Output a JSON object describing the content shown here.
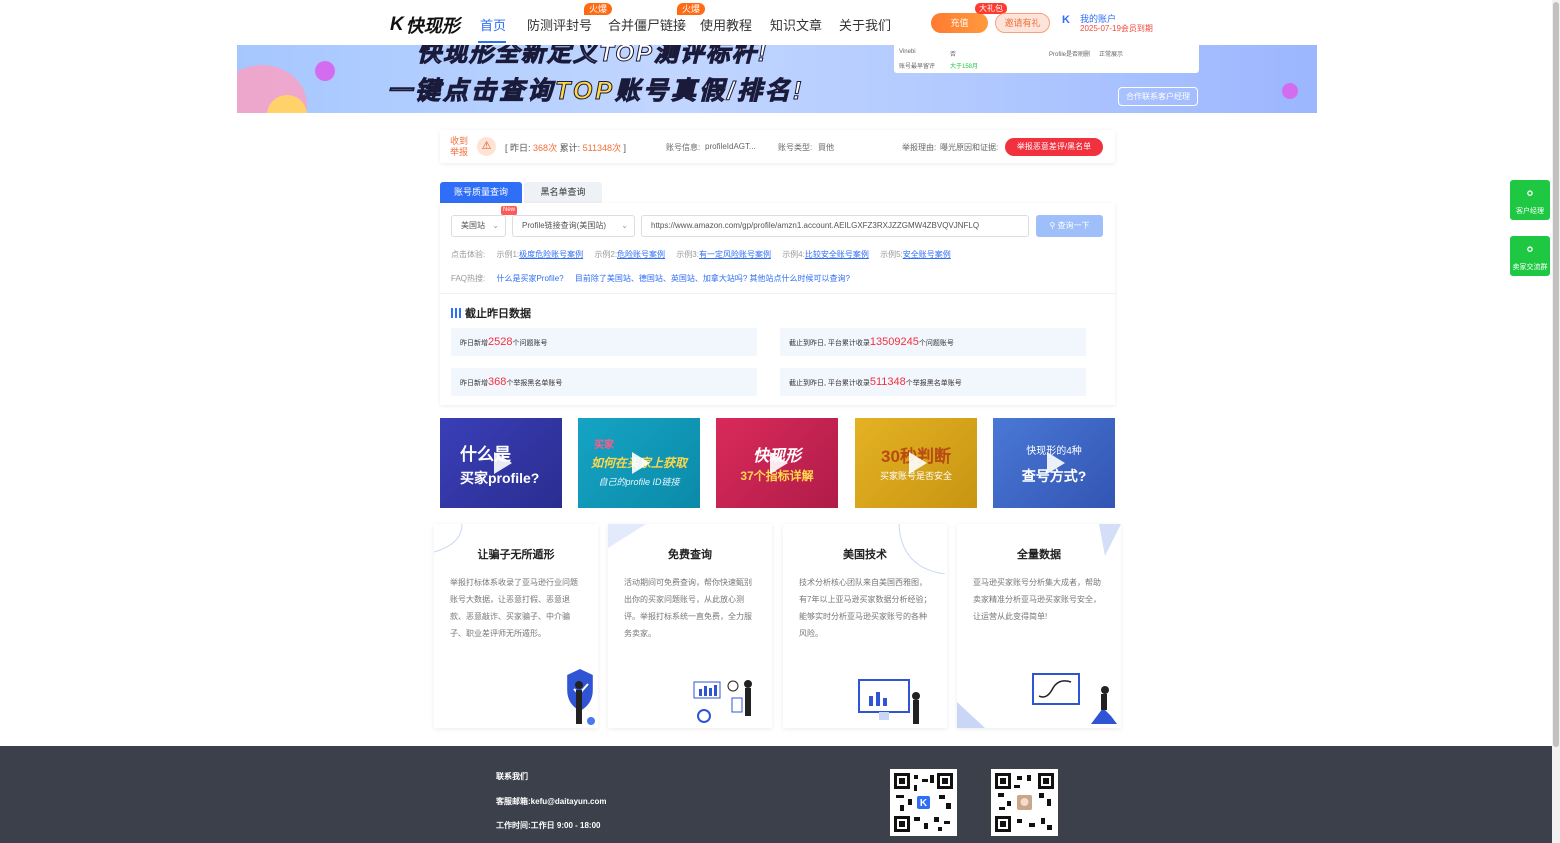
{
  "nav": {
    "logo_text": "快现形",
    "items": [
      {
        "label": "首页"
      },
      {
        "label": "防测评封号",
        "badge": "火爆"
      },
      {
        "label": "合并僵尸链接",
        "badge": "火爆"
      },
      {
        "label": "使用教程"
      },
      {
        "label": "知识文章"
      },
      {
        "label": "关于我们"
      }
    ],
    "recharge_label": "充值",
    "gift_badge": "大礼包",
    "invite_label": "邀请有礼",
    "account_label": "我的账户",
    "member_expiry": "2025-07-19会员到期"
  },
  "banner": {
    "line1": "快现形全新定义TOP测评标杆!",
    "line2_prefix": "一键点击查询",
    "line2_highlight": "TOP",
    "line2_suffix": "账号真假/排名!",
    "card_label_a": "Vinebi",
    "card_value_a": "否",
    "card_label_b": "账号最早留评",
    "card_value_b": "大于158月",
    "card_label_c": "Profile是否刷删",
    "card_value_c": "正常展示",
    "contact_label": "合作联系客户经理"
  },
  "report": {
    "label": "收到举报",
    "yesterday_label": "昨日:",
    "yesterday_value": "368次",
    "total_label": "累计:",
    "total_value": "511348次",
    "account_info_label": "账号信息:",
    "account_info_value": "profileIdAGT...",
    "account_type_label": "账号类型:",
    "account_type_value": "買他",
    "reason_label": "举报理由:",
    "reason_value": "曝光原因和证据:",
    "report_button": "举报恶意差评/黑名单"
  },
  "query": {
    "tab_active": "账号质量查询",
    "tab_inactive": "黑名单查询",
    "site_select": "美国站",
    "new_tag": "New",
    "method_select": "Profile链接查询(美国站)",
    "url_value": "https://www.amazon.com/gp/profile/amzn1.account.AEILGXFZ3RXJZZGMW4ZBVQVJNFLQ",
    "query_button": "查询一下",
    "examples_label": "点击体验:",
    "examples": [
      {
        "prefix": "示例1:",
        "link": "极度危险账号案例"
      },
      {
        "prefix": "示例2:",
        "link": "危险账号案例"
      },
      {
        "prefix": "示例3:",
        "link": "有一定风险账号案例"
      },
      {
        "prefix": "示例4:",
        "link": "比较安全账号案例"
      },
      {
        "prefix": "示例5:",
        "link": "安全账号案例"
      }
    ],
    "faq_label": "FAQ热搜:",
    "faq_links": [
      "什么是买家Profile?",
      "目前除了美国站、德国站、英国站、加拿大站吗? 其他站点什么时候可以查询?"
    ]
  },
  "stats": {
    "title": "截止昨日数据",
    "items": [
      {
        "prefix": "昨日新增",
        "value": "2528",
        "suffix": "个问题账号"
      },
      {
        "prefix": "截止到昨日, 平台累计收录",
        "value": "13509245",
        "suffix": "个问题账号"
      },
      {
        "prefix": "昨日新增",
        "value": "368",
        "suffix": "个举报黑名单账号"
      },
      {
        "prefix": "截止到昨日, 平台累计收录",
        "value": "511348",
        "suffix": "个举报黑名单账号"
      }
    ]
  },
  "videos": [
    {
      "title_line1": "什么是",
      "title_line2": "买家profile?"
    },
    {
      "title_line1": "如何在买家上获取",
      "title_line2": "自己的profile ID链接",
      "tag": "买家"
    },
    {
      "title_line1": "快现形",
      "title_line2": "37个指标详解"
    },
    {
      "title_line1": "30秒判断",
      "title_line2": "买家账号是否安全"
    },
    {
      "title_line1": "快现形的4种",
      "title_line2": "查号方式?"
    }
  ],
  "features": [
    {
      "title": "让骗子无所遁形",
      "desc": "举报打标体系收录了亚马逊行业问题账号大数据，让恶意打假、恶意退款、恶意敲诈、买家骗子、中介骗子、职业差评师无所遁形。"
    },
    {
      "title": "免费查询",
      "desc": "活动期间可免费查询，帮你快速甄别出你的买家问题账号，从此放心测评。举报打标系统一直免费，全力服务卖家。"
    },
    {
      "title": "美国技术",
      "desc": "技术分析核心团队来自美国西雅图，有7年以上亚马逊买家数据分析经验；能够实时分析亚马逊买家账号的各种风险。"
    },
    {
      "title": "全量数据",
      "desc": "亚马逊买家账号分析集大成者，帮助卖家精准分析亚马逊买家账号安全，让运营从此变得简单!"
    }
  ],
  "side": {
    "service_label": "客户经理",
    "group_label": "卖家交流群"
  },
  "footer": {
    "contact_title": "联系我们",
    "email_label": "客服邮箱:",
    "email_value": "kefu@daitayun.com",
    "hours_label": "工作时间:",
    "hours_value": "工作日 9:00 - 18:00"
  },
  "colors": {
    "primary": "#2f6ef6",
    "accent_red": "#f2313f",
    "accent_orange": "#f26f3b",
    "wechat_green": "#1ec843",
    "footer_bg": "#3b404b"
  }
}
